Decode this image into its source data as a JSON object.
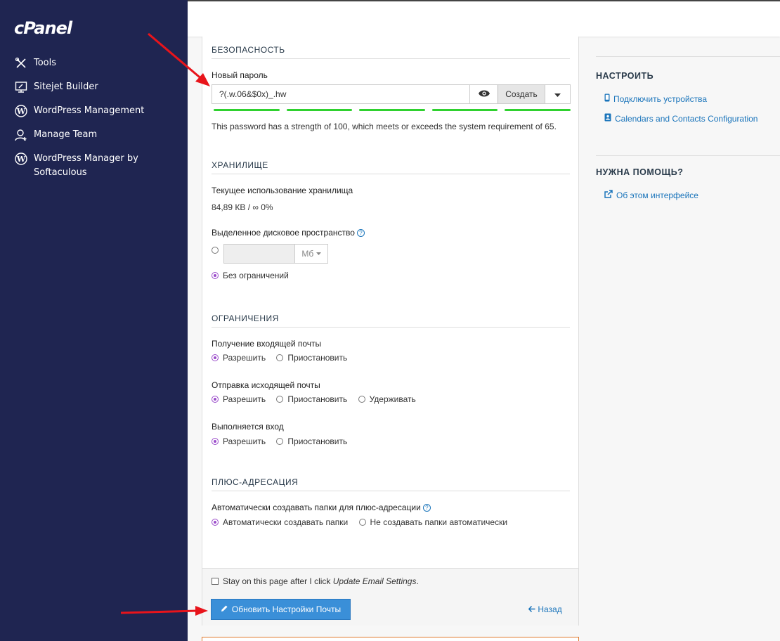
{
  "brand": {
    "logo": "cPanel"
  },
  "sidebar": {
    "items": [
      {
        "label": "Tools",
        "icon": "tools-icon"
      },
      {
        "label": "Sitejet Builder",
        "icon": "sitejet-icon"
      },
      {
        "label": "WordPress Management",
        "icon": "wordpress-icon"
      },
      {
        "label": "Manage Team",
        "icon": "manage-team-icon"
      },
      {
        "label": "WordPress Manager by Softaculous",
        "icon": "wordpress-icon"
      }
    ]
  },
  "security": {
    "title": "БЕЗОПАСНОСТЬ",
    "new_password_label": "Новый пароль",
    "password_value": "?(.w.06&$0x)_.hw",
    "generate_label": "Создать",
    "strength_text": "This password has a strength of 100, which meets or exceeds the system requirement of 65."
  },
  "storage": {
    "title": "ХРАНИЛИЩЕ",
    "usage_label": "Текущее использование хранилища",
    "usage_value": "84,89 КВ / ∞ 0%",
    "quota_label": "Выделенное дисковое пространство",
    "quota_unit": "Мб",
    "unlimited_label": "Без ограничений"
  },
  "limits": {
    "title": "ОГРАНИЧЕНИЯ",
    "incoming_label": "Получение входящей почты",
    "outgoing_label": "Отправка исходящей почты",
    "login_label": "Выполняется вход",
    "allow": "Разрешить",
    "suspend": "Приостановить",
    "hold": "Удерживать"
  },
  "plus": {
    "title": "ПЛЮС-АДРЕСАЦИЯ",
    "auto_label": "Автоматически создавать папки для плюс-адресации",
    "auto_opt": "Автоматически создавать папки",
    "no_auto_opt": "Не создавать папки автоматически"
  },
  "footer": {
    "stay_prefix": "Stay on this page after I click ",
    "stay_em": "Update Email Settings",
    "stay_suffix": ".",
    "update_button": "Обновить Настройки Почты",
    "back_link": "Назад"
  },
  "right": {
    "configure_title": "НАСТРОИТЬ",
    "connect_devices": "Подключить устройства",
    "calendars": "Calendars and Contacts Configuration",
    "help_title": "НУЖНА ПОМОЩЬ?",
    "about": "Об этом интерфейсе"
  },
  "colors": {
    "sidebar": "#1f2551",
    "accent": "#1b75bb",
    "radio": "#9b4dca",
    "strength": "#2fd12f",
    "arrow": "#e8141b"
  }
}
